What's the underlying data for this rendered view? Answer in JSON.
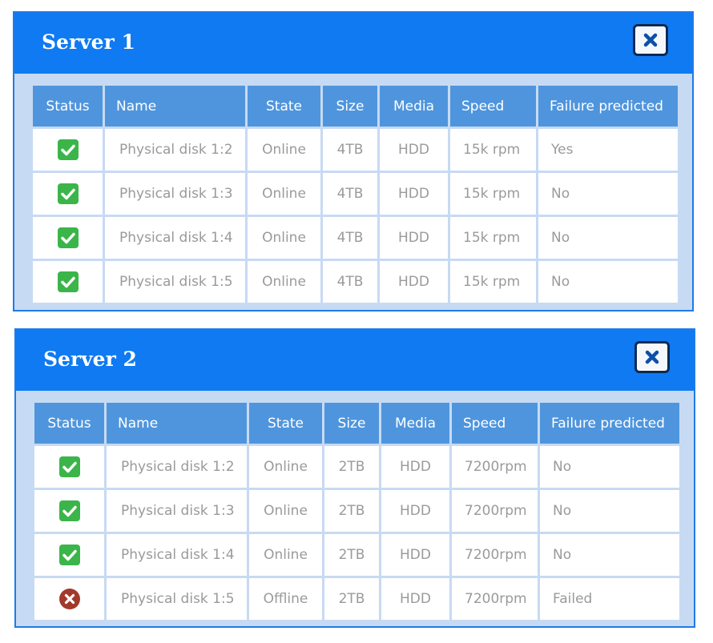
{
  "columns": [
    "Status",
    "Name",
    "State",
    "Size",
    "Media",
    "Speed",
    "Failure predicted"
  ],
  "colors": {
    "header_blue": "#0f7af2",
    "column_header": "#4f95dd",
    "panel_background": "#c7daf3",
    "ok_green": "#3bb54a",
    "failed_red": "#a23a2c"
  },
  "servers": [
    {
      "title": "Server 1",
      "rows": [
        {
          "status": "ok",
          "name": "Physical disk 1:2",
          "state": "Online",
          "size": "4TB",
          "media": "HDD",
          "speed": "15k rpm",
          "failure": "Yes"
        },
        {
          "status": "ok",
          "name": "Physical disk 1:3",
          "state": "Online",
          "size": "4TB",
          "media": "HDD",
          "speed": "15k rpm",
          "failure": "No"
        },
        {
          "status": "ok",
          "name": "Physical disk 1:4",
          "state": "Online",
          "size": "4TB",
          "media": "HDD",
          "speed": "15k rpm",
          "failure": "No"
        },
        {
          "status": "ok",
          "name": "Physical disk 1:5",
          "state": "Online",
          "size": "4TB",
          "media": "HDD",
          "speed": "15k rpm",
          "failure": "No"
        }
      ]
    },
    {
      "title": "Server 2",
      "rows": [
        {
          "status": "ok",
          "name": "Physical disk 1:2",
          "state": "Online",
          "size": "2TB",
          "media": "HDD",
          "speed": "7200rpm",
          "failure": "No"
        },
        {
          "status": "ok",
          "name": "Physical disk 1:3",
          "state": "Online",
          "size": "2TB",
          "media": "HDD",
          "speed": "7200rpm",
          "failure": "No"
        },
        {
          "status": "ok",
          "name": "Physical disk 1:4",
          "state": "Online",
          "size": "2TB",
          "media": "HDD",
          "speed": "7200rpm",
          "failure": "No"
        },
        {
          "status": "failed",
          "name": "Physical disk 1:5",
          "state": "Offline",
          "size": "2TB",
          "media": "HDD",
          "speed": "7200rpm",
          "failure": "Failed"
        }
      ]
    }
  ]
}
